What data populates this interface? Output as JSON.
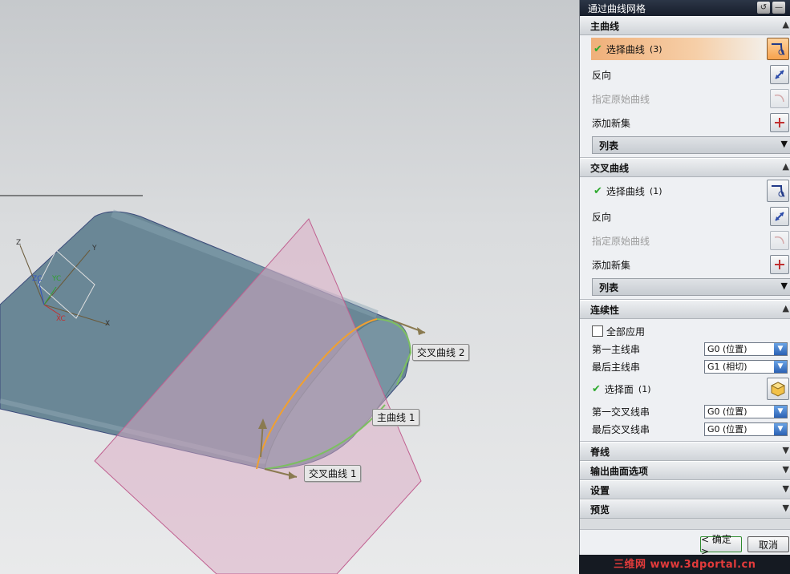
{
  "viewport": {
    "axes": {
      "z": "Z",
      "y": "Y",
      "x": "X",
      "zc": "ZC",
      "yc": "YC",
      "xc": "XC"
    },
    "labels": {
      "cross_curve_2": "交叉曲线 2",
      "main_curve_1": "主曲线 1",
      "cross_curve_1": "交叉曲线 1"
    },
    "colors": {
      "body": "#6a8796",
      "plane": "#dba9c4",
      "curve": "#f0a030"
    }
  },
  "dialog": {
    "title": "通过曲线网格",
    "sections": {
      "main_curves": {
        "title": "主曲线",
        "select_curve": "选择曲线",
        "select_count": "(3)",
        "reverse": "反向",
        "specify_origin": "指定原始曲线",
        "add_new_set": "添加新集",
        "list": "列表"
      },
      "cross_curves": {
        "title": "交叉曲线",
        "select_curve": "选择曲线",
        "select_count": "(1)",
        "reverse": "反向",
        "specify_origin": "指定原始曲线",
        "add_new_set": "添加新集",
        "list": "列表"
      },
      "continuity": {
        "title": "连续性",
        "apply_all": "全部应用",
        "first_main": "第一主线串",
        "first_main_value": "G0 (位置)",
        "last_main": "最后主线串",
        "last_main_value": "G1 (相切)",
        "select_face": "选择面",
        "select_face_count": "(1)",
        "first_cross": "第一交叉线串",
        "first_cross_value": "G0 (位置)",
        "last_cross": "最后交叉线串",
        "last_cross_value": "G0 (位置)"
      },
      "spine": {
        "title": "脊线"
      },
      "output_options": {
        "title": "输出曲面选项"
      },
      "settings": {
        "title": "设置"
      },
      "preview": {
        "title": "预览"
      }
    },
    "buttons": {
      "ok": "< 确定 >",
      "cancel": "取消"
    }
  },
  "watermark": "三维网 www.3dportal.cn"
}
